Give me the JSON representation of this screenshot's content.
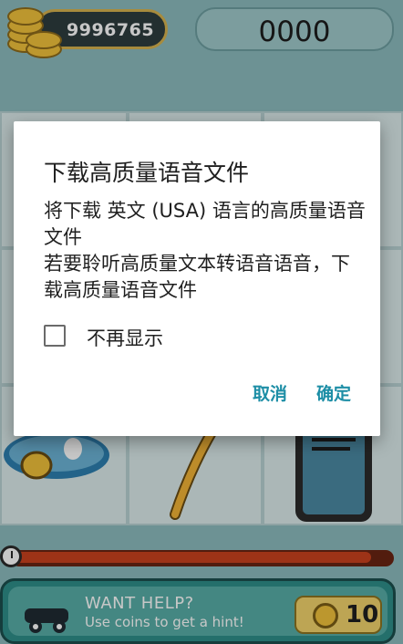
{
  "game": {
    "coins": "9996765",
    "score": "0000",
    "timer_remaining_fraction": 0.94,
    "help": {
      "title": "WANT HELP?",
      "subtitle": "Use coins to get a hint!",
      "hint_cost": "10"
    }
  },
  "dialog": {
    "title": "下载高质量语音文件",
    "message": "将下载 英文 (USA) 语言的高质量语音文件\n若要聆听高质量文本转语音语音，下载高质量语音文件",
    "checkbox_label": "不再显示",
    "checkbox_checked": false,
    "cancel_label": "取消",
    "ok_label": "确定"
  },
  "colors": {
    "accent": "#1d8ea6",
    "background": "#8cbcbe",
    "dialog_background": "#ffffff"
  }
}
